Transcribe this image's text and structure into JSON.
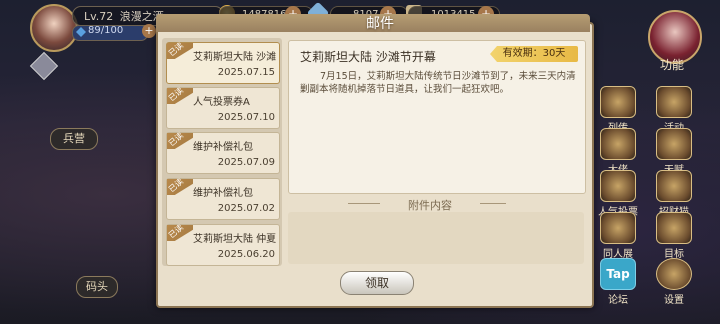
{
  "hud": {
    "level_text": "Lv.72",
    "player_name": "浪漫之酒",
    "stamina": "89/100",
    "resources": [
      "14878169",
      "8107",
      "1013415"
    ]
  },
  "left_buttons": {
    "barracks": "兵营",
    "dock": "码头"
  },
  "side_menu": [
    {
      "label": "功能"
    },
    {
      "label": "列传"
    },
    {
      "label": "活动"
    },
    {
      "label": "大佬"
    },
    {
      "label": "天赋"
    },
    {
      "label": "人气投票"
    },
    {
      "label": "招财猫"
    },
    {
      "label": "同人展"
    },
    {
      "label": "目标"
    },
    {
      "label": "论坛"
    },
    {
      "label": "设置"
    }
  ],
  "tap_logo": "Tap",
  "mail": {
    "title": "邮件",
    "items": [
      {
        "read_badge": "已读",
        "title": "艾莉斯坦大陆 沙滩",
        "date": "2025.07.15",
        "selected": true
      },
      {
        "read_badge": "已读",
        "title": "人气投票券A",
        "date": "2025.07.10",
        "selected": false
      },
      {
        "read_badge": "已读",
        "title": "维护补偿礼包",
        "date": "2025.07.09",
        "selected": false
      },
      {
        "read_badge": "已读",
        "title": "维护补偿礼包",
        "date": "2025.07.02",
        "selected": false
      },
      {
        "read_badge": "已读",
        "title": "艾莉斯坦大陆 仲夏",
        "date": "2025.06.20",
        "selected": false
      }
    ],
    "detail": {
      "title": "艾莉斯坦大陆 沙滩节开幕",
      "valid_period": "有效期：30天",
      "body": "7月15日，艾莉斯坦大陆传统节日沙滩节到了，未来三天内清剿副本将随机掉落节日道具，让我们一起狂欢吧。"
    },
    "attachment_label": "附件内容",
    "claim_button": "领取"
  },
  "colors": {
    "dialog_bg": "#e9dfcb",
    "badge_gold": "#f2d36d",
    "ribbon": "#b98a4c"
  }
}
